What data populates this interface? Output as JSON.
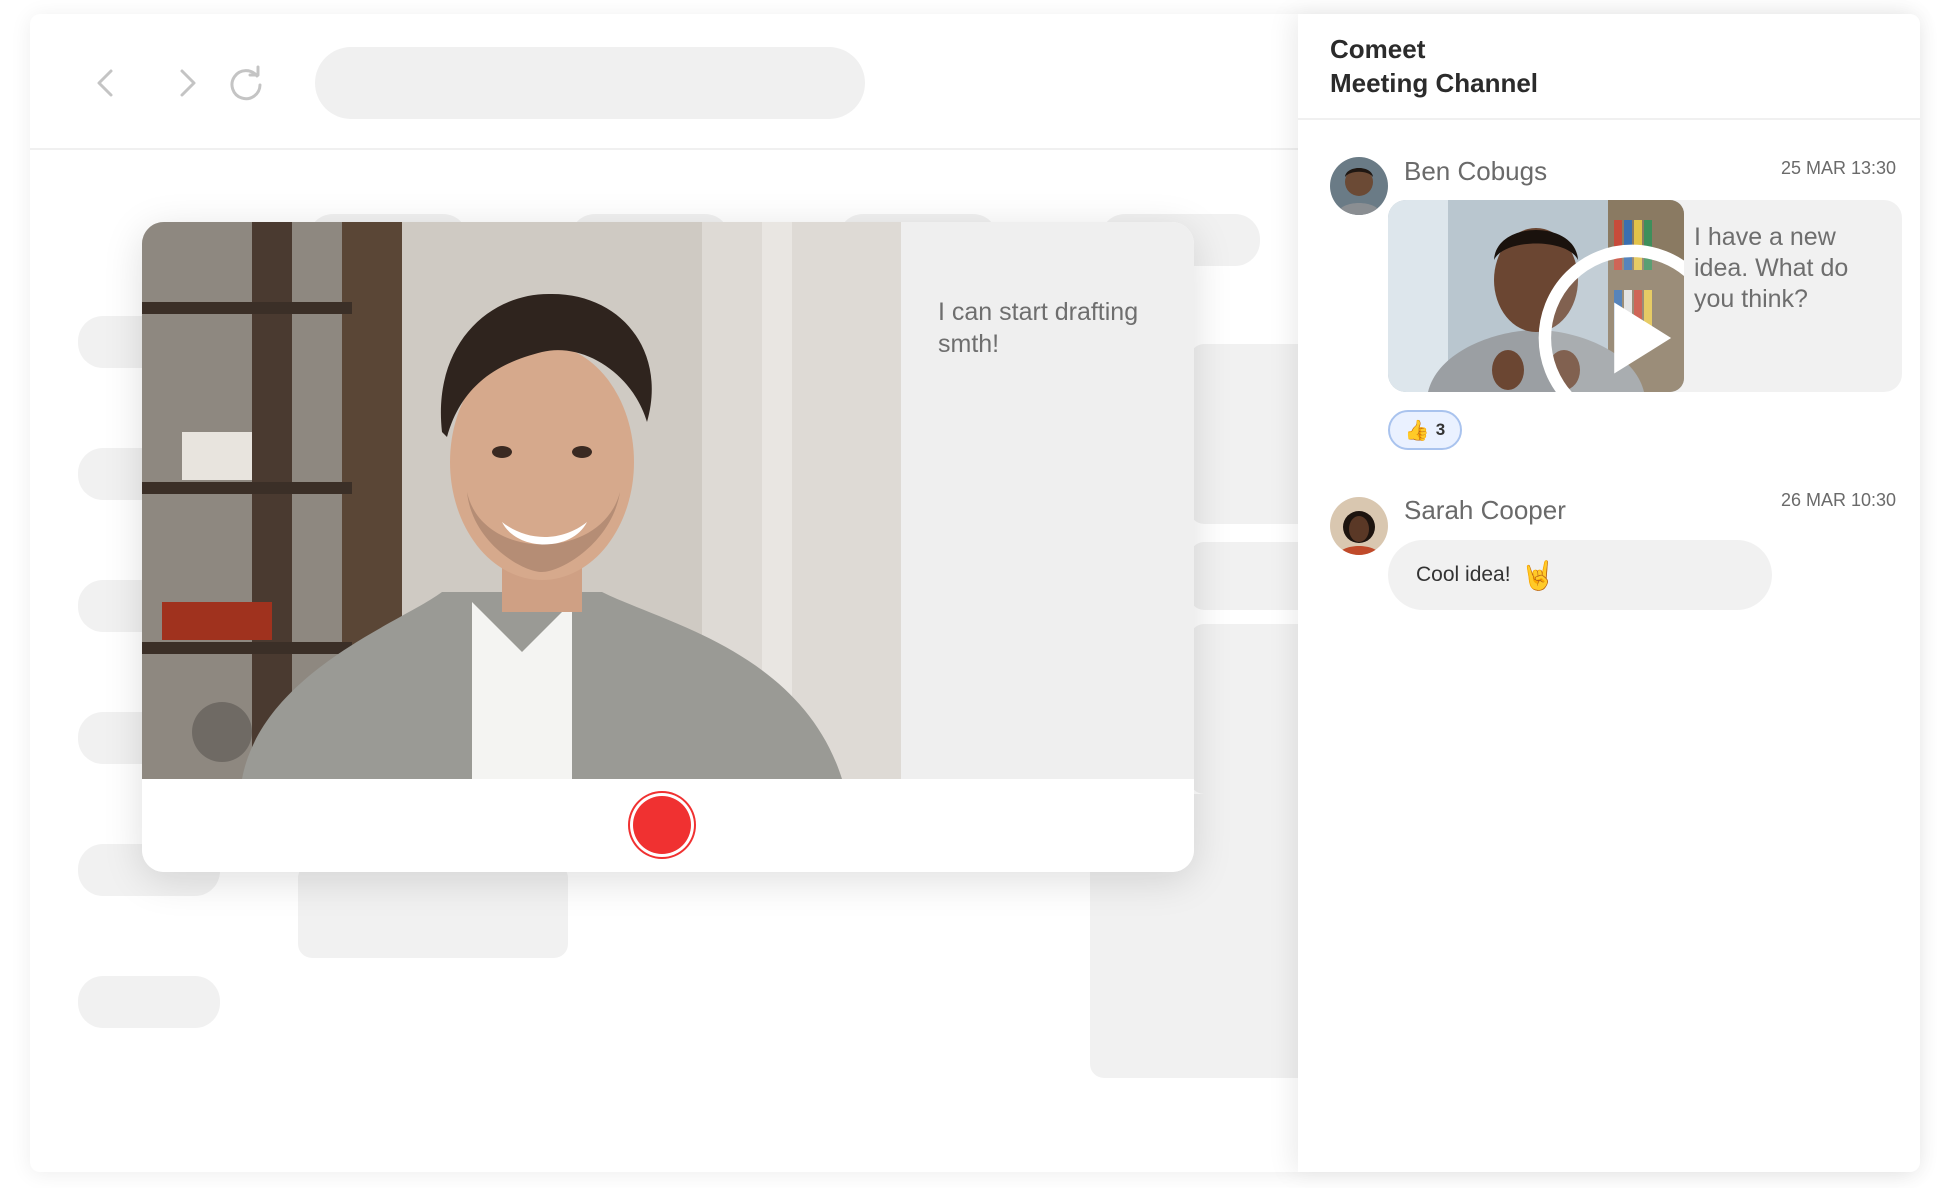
{
  "browser": {
    "back_icon": "chevron-left-icon",
    "forward_icon": "chevron-right-icon",
    "reload_icon": "reload-icon",
    "address_bar": ""
  },
  "recorder": {
    "script_text": "I can start drafting smth!",
    "record_button_color": "#f03131"
  },
  "chat": {
    "title_line1": "Comeet",
    "title_line2": "Meeting Channel",
    "messages": [
      {
        "sender": "Ben Cobugs",
        "time": "25 MAR 13:30",
        "type": "video",
        "text": "I have a new idea. What do you think?",
        "reaction": {
          "emoji": "👍",
          "count": "3",
          "icon": "thumbs-up-icon"
        }
      },
      {
        "sender": "Sarah Cooper",
        "time": "26 MAR 10:30",
        "type": "text",
        "text": "Cool idea!",
        "emoji": "🤘",
        "emoji_icon": "rock-on-hand-icon"
      }
    ]
  },
  "colors": {
    "accent_red": "#f03131",
    "reaction_border": "#a9c3ee",
    "bubble_bg": "#f1f1f1"
  }
}
